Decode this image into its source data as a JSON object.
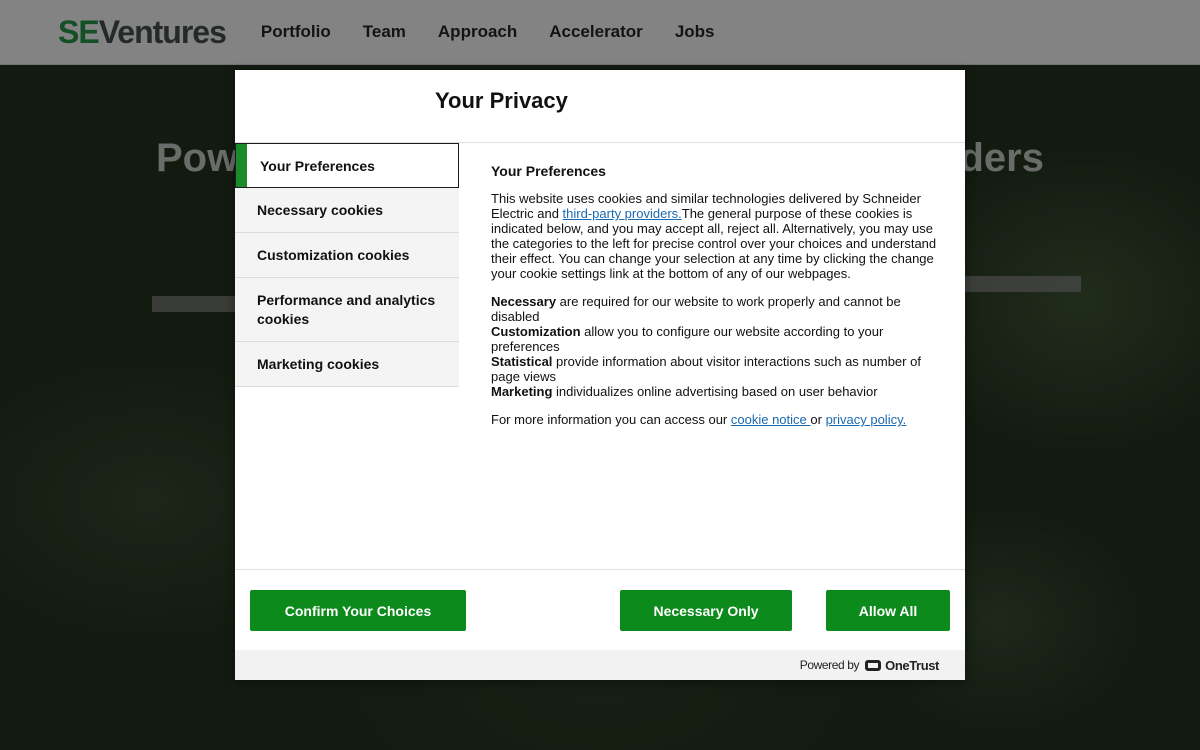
{
  "header": {
    "logo_se": "SE",
    "logo_ventures": "Ventures",
    "nav": [
      "Portfolio",
      "Team",
      "Approach",
      "Accelerator",
      "Jobs"
    ]
  },
  "hero": {
    "heading_left": "Pow",
    "heading_right": "ders"
  },
  "modal": {
    "title": "Your Privacy",
    "tabs": [
      {
        "label": "Your Preferences",
        "active": true
      },
      {
        "label": "Necessary cookies"
      },
      {
        "label": "Customization cookies"
      },
      {
        "label": "Performance and analytics cookies"
      },
      {
        "label": "Marketing cookies"
      }
    ],
    "content": {
      "title": "Your Preferences",
      "intro_before_link": "This website uses cookies and similar technologies delivered by Schneider Electric and ",
      "intro_link": "third-party providers.",
      "intro_after_link": "The general purpose of these cookies is indicated below, and you may accept all, reject all. Alternatively, you may use the categories to the left for precise control over your choices and understand their effect. You can change your selection at any time by clicking the change your cookie settings link at the bottom of any of our webpages.",
      "definitions": [
        {
          "term": "Necessary",
          "text": " are required for our website to work properly and cannot be disabled"
        },
        {
          "term": "Customization",
          "text": " allow you to configure our website according to your preferences"
        },
        {
          "term": "Statistical",
          "text": " provide information about visitor interactions such as number of page views"
        },
        {
          "term": "Marketing",
          "text": " individualizes online advertising based on user behavior"
        }
      ],
      "more_info_text": "For more information you can access our ",
      "cookie_notice_link": "cookie notice ",
      "or_text": "or ",
      "privacy_policy_link": "privacy policy."
    },
    "buttons": {
      "confirm": "Confirm Your Choices",
      "necessary_only": "Necessary Only",
      "allow_all": "Allow All"
    },
    "powered_by": "Powered by",
    "onetrust": "OneTrust"
  },
  "colors": {
    "brand_green": "#0d8a1c",
    "logo_green": "#1f7a3a",
    "link_blue": "#1a6ab0"
  }
}
